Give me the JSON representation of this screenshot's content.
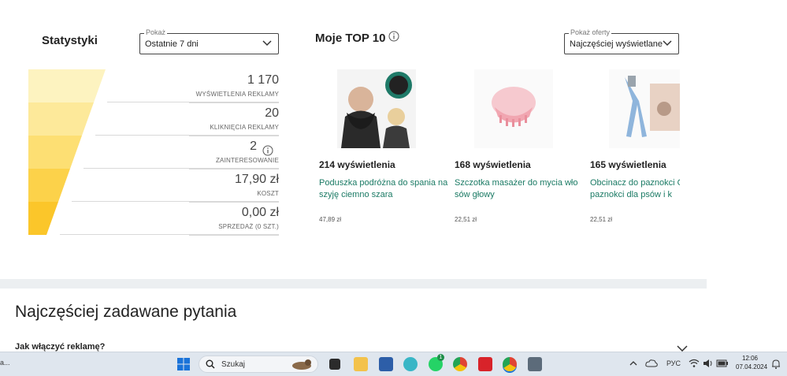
{
  "stats": {
    "title": "Statystyki",
    "filter_legend": "Pokaż",
    "filter_value": "Ostatnie 7 dni",
    "rows": [
      {
        "value": "1 170",
        "label": "WYŚWIETLENIA REKLAMY"
      },
      {
        "value": "20",
        "label": "KLIKNIĘCIA REKLAMY"
      },
      {
        "value": "2",
        "label": "ZAINTERESOWANIE"
      },
      {
        "value": "17,90 zł",
        "label": "KOSZT"
      },
      {
        "value": "0,00 zł",
        "label": "SPRZEDAŻ (0 SZT.)"
      }
    ],
    "funnel_colors": [
      "#fdf3c0",
      "#fde99a",
      "#fddf73",
      "#fcd24a",
      "#fbc62a"
    ]
  },
  "top10": {
    "title": "Moje TOP 10",
    "filter_legend": "Pokaż oferty",
    "filter_value": "Najczęściej wyświetlane",
    "products": [
      {
        "views": "214 wyświetlenia",
        "name": "Poduszka podróżna do spania na szyję ciemno szara",
        "price": "47,89 zł"
      },
      {
        "views": "168 wyświetlenia",
        "name": "Szczotka masażer do mycia wło sów głowy",
        "price": "22,51 zł"
      },
      {
        "views": "165 wyświetlenia",
        "name": "Obcinacz do paznokci O do paznokci dla psów i k",
        "price": "22,51 zł"
      }
    ]
  },
  "faq": {
    "title": "Najczęściej zadawane pytania",
    "first_question": "Jak włączyć reklamę?"
  },
  "taskbar": {
    "search_placeholder": "Szukaj",
    "left_fragment": "a...",
    "lang": "РУС",
    "time": "12:06",
    "date": "07.04.2024",
    "notif_badge": "1"
  },
  "colors": {
    "accent_link": "#1a7a64",
    "funnel_yellow": "#fbc62a"
  }
}
